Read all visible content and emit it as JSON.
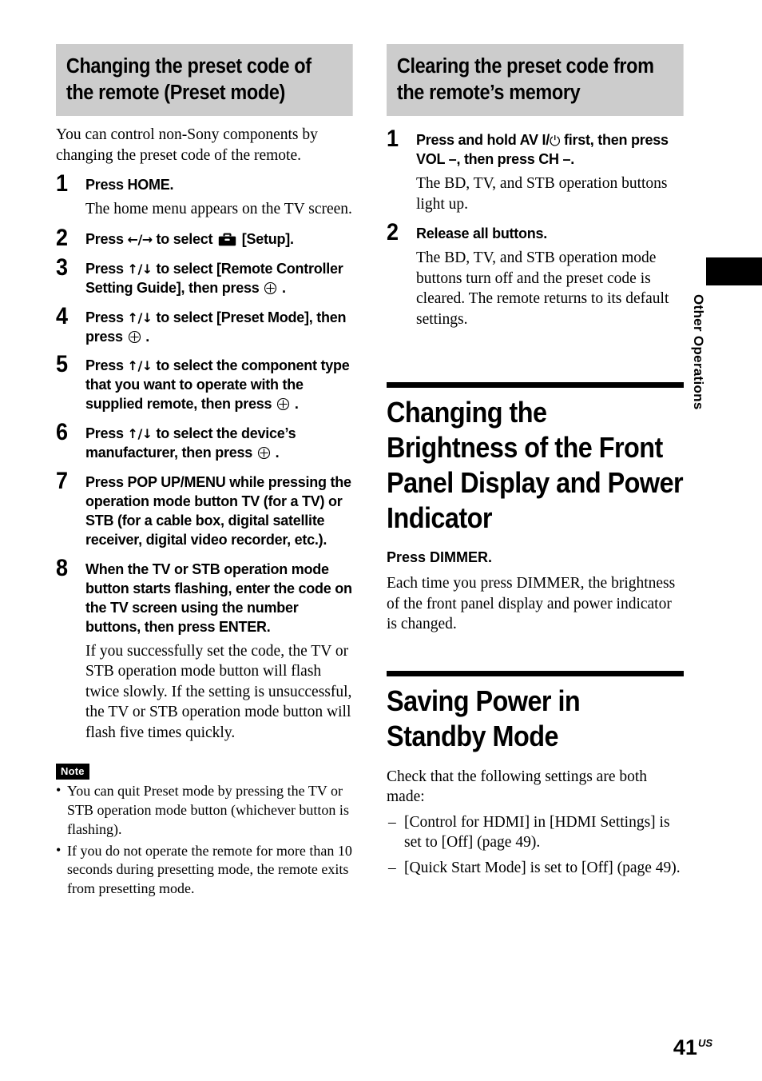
{
  "left_column": {
    "section_heading": "Changing the preset code of the remote (Preset mode)",
    "intro": "You can control non-Sony components by changing the preset code of the remote.",
    "steps": [
      {
        "num": "1",
        "title_pre": "Press HOME.",
        "desc": "The home menu appears on the TV screen."
      },
      {
        "num": "2",
        "title_pre": "Press ",
        "arrows": "←/→",
        "title_mid": " to select ",
        "title_post": " [Setup].",
        "desc": ""
      },
      {
        "num": "3",
        "title_pre": "Press ",
        "arrows": "↑/↓",
        "title_mid": " to select [Remote Controller Setting Guide], then press ",
        "title_post": " .",
        "desc": ""
      },
      {
        "num": "4",
        "title_pre": "Press ",
        "arrows": "↑/↓",
        "title_mid": " to select [Preset Mode], then press ",
        "title_post": " .",
        "desc": ""
      },
      {
        "num": "5",
        "title_pre": "Press ",
        "arrows": "↑/↓",
        "title_mid": " to select the component type that you want to operate with the supplied remote, then press ",
        "title_post": " .",
        "desc": ""
      },
      {
        "num": "6",
        "title_pre": "Press ",
        "arrows": "↑/↓",
        "title_mid": " to select the device’s manufacturer, then press ",
        "title_post": " .",
        "desc": ""
      },
      {
        "num": "7",
        "title_pre": "Press POP UP/MENU while pressing the operation mode button TV (for a TV) or STB (for a cable box, digital satellite receiver, digital video recorder, etc.).",
        "desc": ""
      },
      {
        "num": "8",
        "title_pre": "When the TV or STB operation mode button starts flashing, enter the code on the TV screen using the number buttons, then press ENTER.",
        "desc": "If you successfully set the code, the TV or STB operation mode button will flash twice slowly. If the setting is unsuccessful, the TV or STB operation mode button will flash five times quickly."
      }
    ],
    "note": {
      "badge": "Note",
      "items": [
        "You can quit Preset mode by pressing the TV or STB operation mode button (whichever button is flashing).",
        "If you do not operate the remote for more than 10 seconds during presetting mode, the remote exits from presetting mode."
      ]
    }
  },
  "right_column": {
    "section_heading": "Clearing the preset code from the remote’s memory",
    "steps": [
      {
        "num": "1",
        "title_pre": "Press and hold AV I/",
        "power": "⏻",
        "title_post": " first, then press VOL –, then press CH –.",
        "desc": "The BD, TV, and STB operation buttons light up."
      },
      {
        "num": "2",
        "title_pre": "Release all buttons.",
        "desc": "The BD, TV, and STB operation mode buttons turn off and the preset code is cleared. The remote returns to its default settings."
      }
    ],
    "chapter_1": {
      "heading": "Changing the Brightness of the Front Panel Display and Power Indicator",
      "sub_heading": "Press DIMMER.",
      "body": "Each time you press DIMMER, the brightness of the front panel display and power indicator is changed."
    },
    "chapter_2": {
      "heading": "Saving Power in Standby Mode",
      "body": "Check that the following settings are both made:",
      "items": [
        "[Control for HDMI] in [HDMI Settings] is set to [Off] (page 49).",
        "[Quick Start Mode] is set to [Off] (page 49)."
      ]
    }
  },
  "side_tab": {
    "label": "Other Operations"
  },
  "footer": {
    "page_number": "41",
    "region": "US"
  }
}
